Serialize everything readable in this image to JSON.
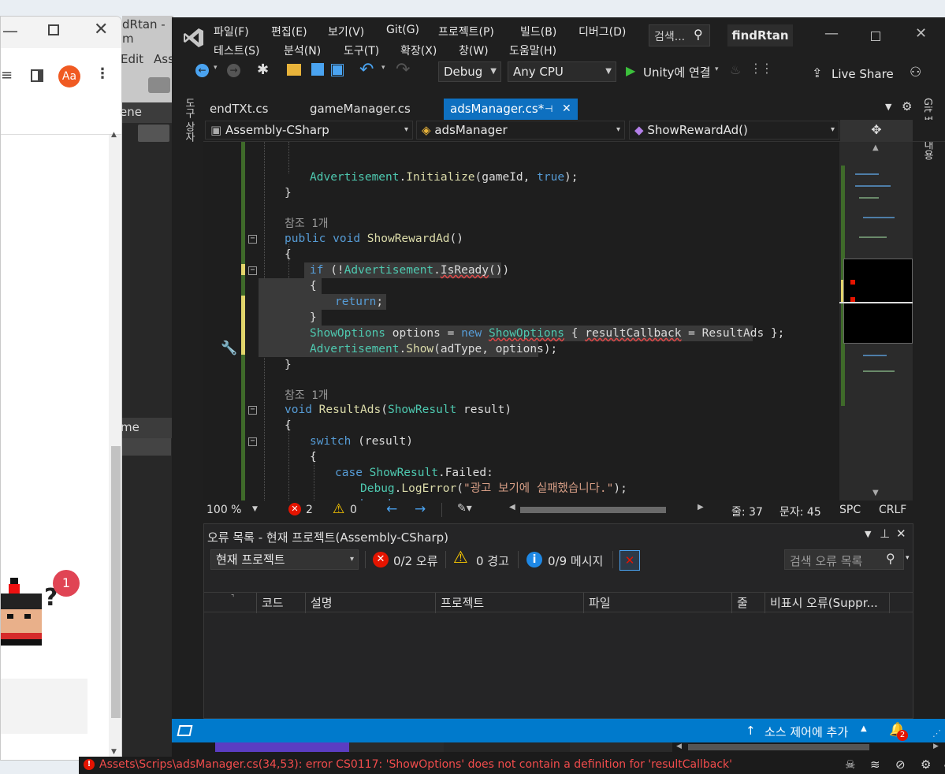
{
  "browser": {
    "title_partial": "dRtan - m",
    "menu_partial": [
      "Edit",
      "Ass"
    ],
    "avatar_initials": "Aa",
    "scene_label": "ene",
    "game_label": "me",
    "notification_count": "1"
  },
  "menu": {
    "row1": [
      "파일(F)",
      "편집(E)",
      "보기(V)",
      "Git(G)",
      "프로젝트(P)",
      "빌드(B)",
      "디버그(D)"
    ],
    "row2": [
      "테스트(S)",
      "분석(N)",
      "도구(T)",
      "확장(X)",
      "창(W)",
      "도움말(H)"
    ],
    "search_label": "검색...",
    "solution_name": "findRtan"
  },
  "toolbar": {
    "config": "Debug",
    "platform": "Any CPU",
    "run_label": "Unity에 연결",
    "live_share": "Live Share"
  },
  "tabs": [
    {
      "label": "endTXt.cs"
    },
    {
      "label": "gameManager.cs"
    },
    {
      "label": "adsManager.cs*"
    }
  ],
  "side": {
    "left_tool": "도구 상자",
    "right_git": "Git 변경 내용"
  },
  "navbar": {
    "project": "Assembly-CSharp",
    "class": "adsManager",
    "member": "ShowRewardAd()"
  },
  "code": {
    "refs": "참조 1개"
  },
  "editor_status": {
    "zoom": "100 %",
    "errors": "2",
    "warnings": "0",
    "line": "줄: 37",
    "col": "문자: 45",
    "spc": "SPC",
    "eol": "CRLF"
  },
  "error_list": {
    "title": "오류 목록 - 현재 프로젝트(Assembly-CSharp)",
    "scope": "현재 프로젝트",
    "errors_btn": "0/2 오류",
    "warnings_btn": "0 경고",
    "messages_btn": "0/9 메시지",
    "search_placeholder": "검색 오류 목록",
    "columns": [
      "코드",
      "설명",
      "프로젝트",
      "파일",
      "줄",
      "비표시 오류(Suppr..."
    ]
  },
  "statusbar": {
    "source_control": "소스 제어에 추가",
    "notifications": "2"
  },
  "unity_console": {
    "message": "Assets\\Scrips\\adsManager.cs(34,53): error CS0117: 'ShowOptions' does not contain a definition for 'resultCallback'"
  },
  "colors": {
    "accent": "#007acc",
    "tab_active": "#0e70c0",
    "error": "#e51400",
    "warning": "#ffcc00",
    "info": "#1e88e5"
  }
}
